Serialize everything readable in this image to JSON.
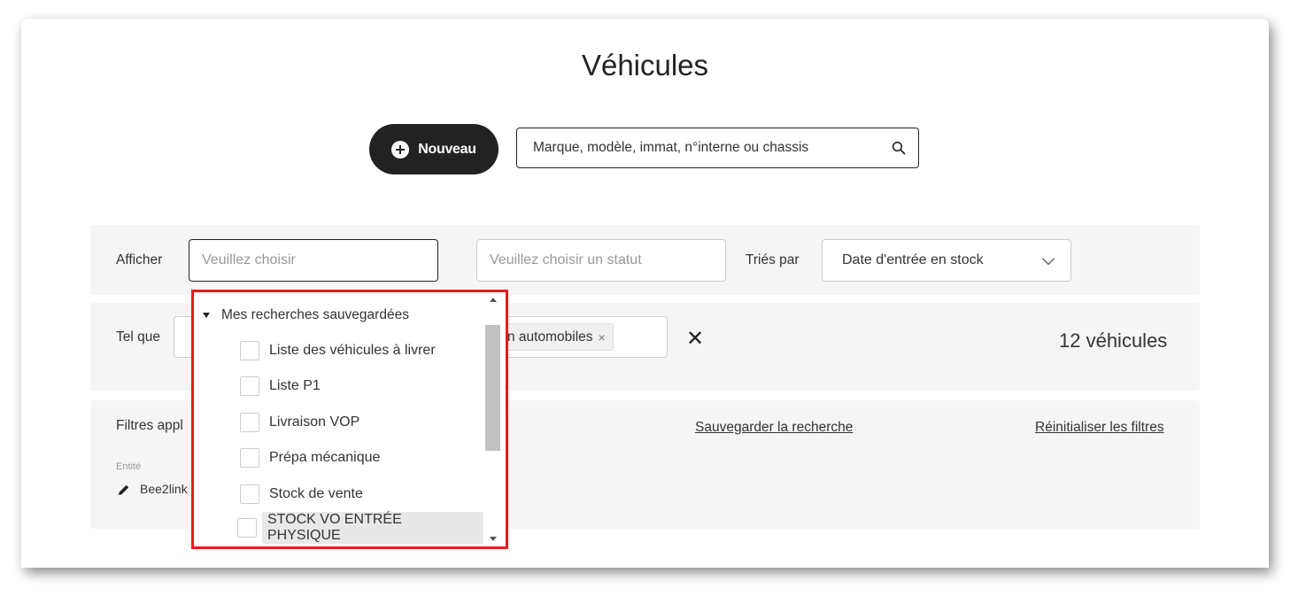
{
  "page": {
    "title": "Véhicules"
  },
  "toolbar": {
    "new_label": "Nouveau",
    "search_placeholder": "Marque, modèle, immat, n°interne ou chassis"
  },
  "filters": {
    "show_label": "Afficher",
    "show_placeholder": "Veuillez choisir",
    "status_placeholder": "Veuillez choisir un statut",
    "sort_label": "Triés par",
    "sort_value": "Date d'entrée en stock",
    "such_as_label": "Tel que",
    "tag_text": "n automobiles",
    "tag_remove": "×",
    "clear": "✕",
    "count": "12 véhicules",
    "applied_label": "Filtres appl",
    "save_search": "Sauvegarder la recherche",
    "reset_filters": "Réinitialiser les filtres",
    "entity_label": "Entité",
    "entity_value": "Bee2link"
  },
  "dropdown": {
    "group_label": "Mes recherches sauvegardées",
    "items": [
      {
        "label": "Liste des véhicules à livrer"
      },
      {
        "label": "Liste P1"
      },
      {
        "label": "Livraison VOP"
      },
      {
        "label": "Prépa mécanique"
      },
      {
        "label": "Stock de vente"
      },
      {
        "label": "STOCK VO ENTRÉE PHYSIQUE"
      }
    ],
    "highlight_color": "#e61d1d"
  }
}
